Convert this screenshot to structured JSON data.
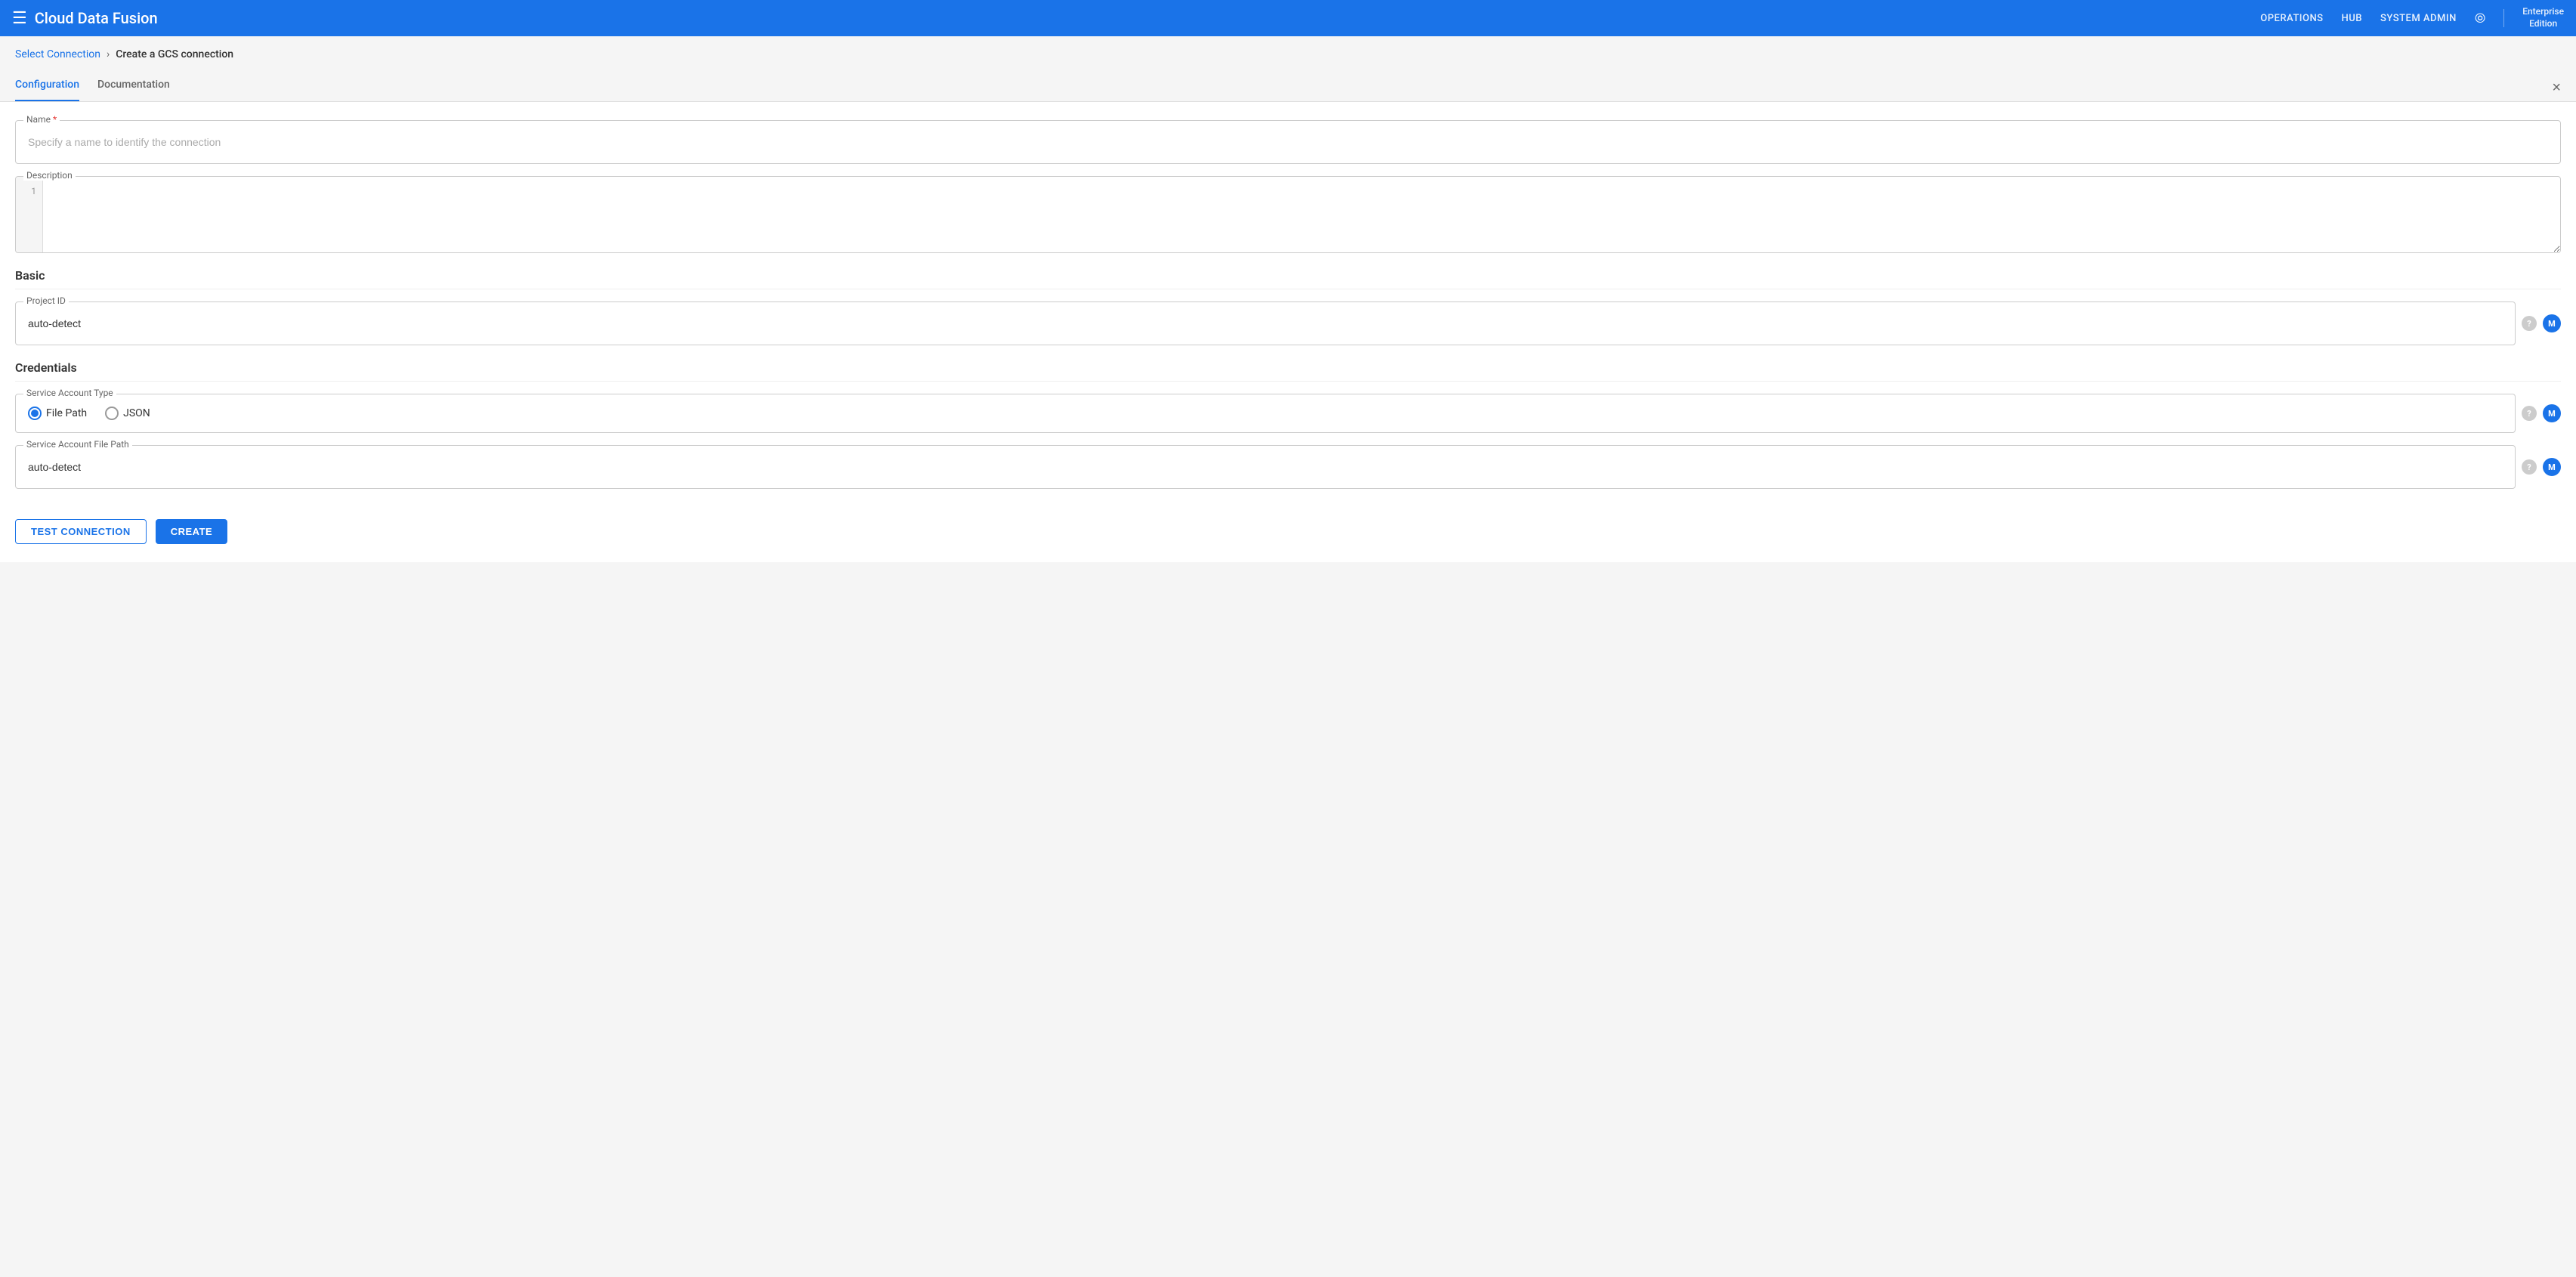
{
  "header": {
    "menu_icon": "☰",
    "logo": "Cloud Data Fusion",
    "nav": {
      "operations": "OPERATIONS",
      "hub": "HUB",
      "system_admin": "SYSTEM ADMIN"
    },
    "enterprise": "Enterprise\nEdition"
  },
  "breadcrumb": {
    "select_connection": "Select Connection",
    "chevron": "›",
    "current_page": "Create a GCS connection"
  },
  "close_button": "×",
  "tabs": {
    "configuration": "Configuration",
    "documentation": "Documentation"
  },
  "form": {
    "name_label": "Name",
    "name_required": "*",
    "name_placeholder": "Specify a name to identify the connection",
    "description_label": "Description",
    "description_line": "1",
    "section_basic": "Basic",
    "project_id_label": "Project ID",
    "project_id_value": "auto-detect",
    "section_credentials": "Credentials",
    "service_account_type_label": "Service Account Type",
    "radio_file_path": "File Path",
    "radio_json": "JSON",
    "service_account_file_path_label": "Service Account File Path",
    "service_account_value": "auto-detect"
  },
  "buttons": {
    "test_connection": "TEST CONNECTION",
    "create": "CREATE"
  },
  "icons": {
    "question": "?",
    "macro": "M"
  }
}
